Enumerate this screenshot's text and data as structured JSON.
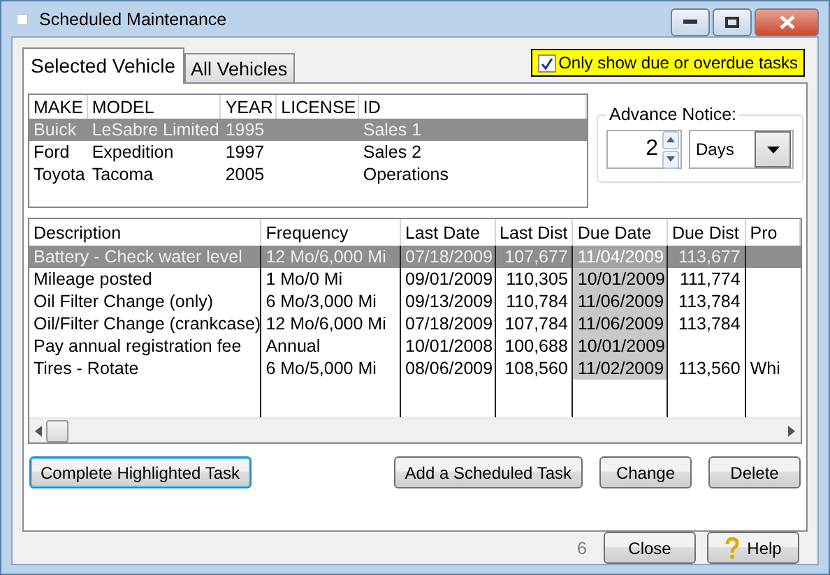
{
  "window": {
    "title": "Scheduled Maintenance"
  },
  "tabs": [
    {
      "label": "Selected Vehicle",
      "selected": true
    },
    {
      "label": "All Vehicles",
      "selected": false
    }
  ],
  "due_filter": {
    "label": "Only show due or overdue tasks",
    "checked": true
  },
  "vehicles": {
    "columns": [
      "MAKE",
      "MODEL",
      "YEAR",
      "LICENSE",
      "ID"
    ],
    "rows": [
      {
        "cells": [
          "Buick",
          "LeSabre Limited",
          "1995",
          "",
          "Sales 1"
        ],
        "selected": true
      },
      {
        "cells": [
          "Ford",
          "Expedition",
          "1997",
          "",
          "Sales 2"
        ],
        "selected": false
      },
      {
        "cells": [
          "Toyota",
          "Tacoma",
          "2005",
          "",
          "Operations"
        ],
        "selected": false
      }
    ]
  },
  "advance_notice": {
    "label": "Advance Notice:",
    "value": "2",
    "unit": "Days"
  },
  "tasks": {
    "columns": [
      "Description",
      "Frequency",
      "Last Date",
      "Last Dist",
      "Due Date",
      "Due Dist",
      "Pro"
    ],
    "rows": [
      {
        "cells": [
          "Battery - Check water level",
          "12 Mo/6,000 Mi",
          "07/18/2009",
          "107,677",
          "11/04/2009",
          "113,677",
          ""
        ],
        "selected": true,
        "due": true
      },
      {
        "cells": [
          "Mileage posted",
          "1 Mo/0 Mi",
          "09/01/2009",
          "110,305",
          "10/01/2009",
          "111,774",
          ""
        ],
        "selected": false,
        "due": true
      },
      {
        "cells": [
          "Oil Filter Change (only)",
          "6 Mo/3,000 Mi",
          "09/13/2009",
          "110,784",
          "11/06/2009",
          "113,784",
          ""
        ],
        "selected": false,
        "due": true
      },
      {
        "cells": [
          "Oil/Filter Change (crankcase)",
          "12 Mo/6,000 Mi",
          "07/18/2009",
          "107,784",
          "11/06/2009",
          "113,784",
          ""
        ],
        "selected": false,
        "due": true
      },
      {
        "cells": [
          "Pay annual registration fee",
          "Annual",
          "10/01/2008",
          "100,688",
          "10/01/2009",
          "",
          ""
        ],
        "selected": false,
        "due": true
      },
      {
        "cells": [
          "Tires - Rotate",
          "6 Mo/5,000 Mi",
          "08/06/2009",
          "108,560",
          "11/02/2009",
          "113,560",
          "Whi"
        ],
        "selected": false,
        "due": true
      }
    ]
  },
  "task_buttons": [
    {
      "label": "Complete Highlighted Task",
      "focused": true
    },
    {
      "label": "Add a Scheduled Task",
      "focused": false
    },
    {
      "label": "Change",
      "focused": false
    },
    {
      "label": "Delete",
      "focused": false
    }
  ],
  "count": "6",
  "footer_buttons": [
    {
      "label": "Close",
      "kind": "plain"
    },
    {
      "label": "Help",
      "kind": "help"
    }
  ]
}
